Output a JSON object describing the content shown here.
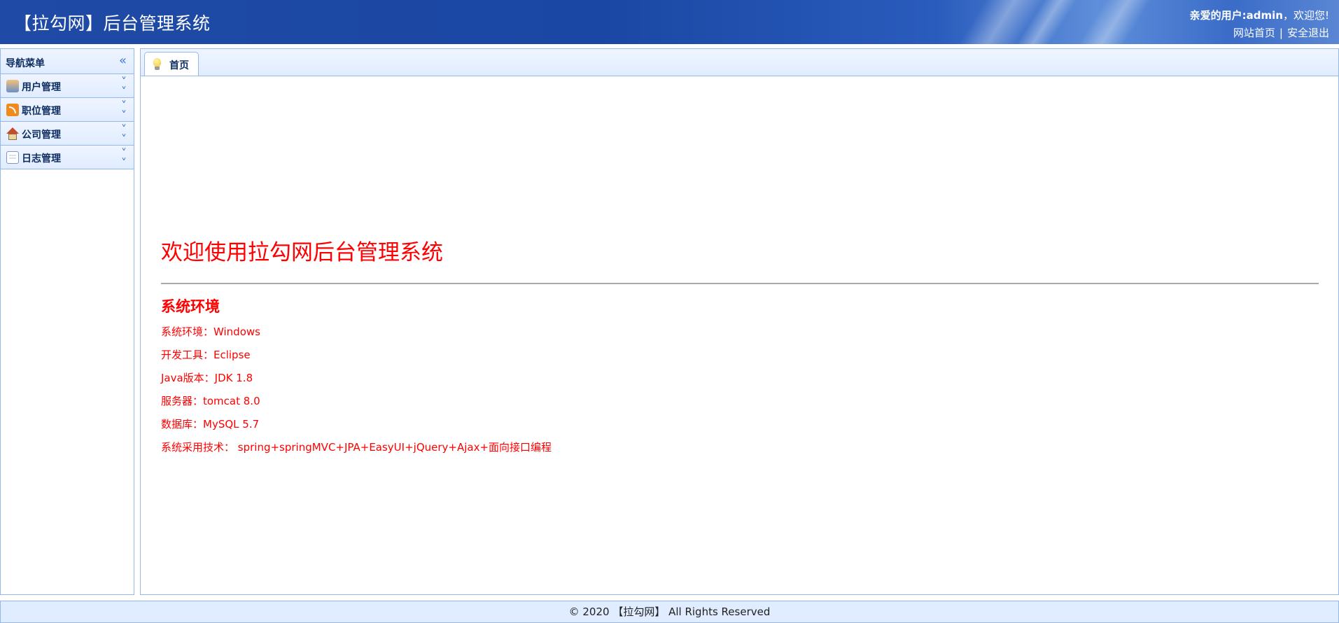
{
  "header": {
    "app_title": "【拉勾网】后台管理系统",
    "greeting_prefix": "亲爱的用户:",
    "username": "admin",
    "greeting_suffix": "，欢迎您!",
    "home_link": "网站首页",
    "separator": "|",
    "logout_link": "安全退出"
  },
  "nav": {
    "title": "导航菜单",
    "collapse_icon": "double-chevron-left",
    "items": [
      {
        "label": "用户管理",
        "icon": "user-admin-icon"
      },
      {
        "label": "职位管理",
        "icon": "rss-icon"
      },
      {
        "label": "公司管理",
        "icon": "home-icon"
      },
      {
        "label": "日志管理",
        "icon": "log-icon"
      }
    ]
  },
  "tabs": [
    {
      "label": "首页",
      "icon": "lightbulb-icon",
      "active": true
    }
  ],
  "content": {
    "welcome": "欢迎使用拉勾网后台管理系统",
    "env_title": "系统环境",
    "env_lines": [
      "系统环境：Windows",
      "开发工具：Eclipse",
      "Java版本：JDK 1.8",
      "服务器：tomcat 8.0",
      "数据库：MySQL 5.7",
      "系统采用技术： spring+springMVC+JPA+EasyUI+jQuery+Ajax+面向接口编程"
    ]
  },
  "footer": {
    "text": "© 2020 【拉勾网】 All Rights Reserved"
  },
  "colors": {
    "header_blue": "#1f4ba6",
    "panel_border": "#95b8e7",
    "panel_header": "#e0ecff",
    "welcome_red": "#ff0000"
  }
}
